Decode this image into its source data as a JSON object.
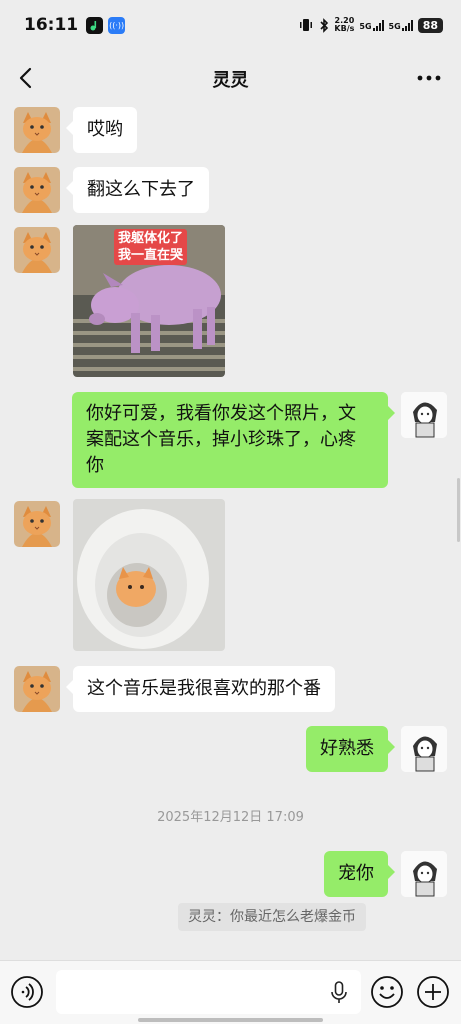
{
  "status_bar": {
    "time": "16:11",
    "net_speed_value": "2.20",
    "net_speed_unit": "KB/s",
    "signal1": "5G",
    "signal2": "5G",
    "battery": "88"
  },
  "nav": {
    "title": "灵灵",
    "back_icon": "chevron-left-icon",
    "more_icon": "more-horizontal-icon"
  },
  "messages": [
    {
      "from": "other",
      "type": "text",
      "text": "哎哟"
    },
    {
      "from": "other",
      "type": "text",
      "text": "翻这么下去了"
    },
    {
      "from": "other",
      "type": "image",
      "description": "pig",
      "caption_line1": "我躯体化了",
      "caption_line2": "我一直在哭"
    },
    {
      "from": "me",
      "type": "text",
      "text_line1": "你好可爱，我看你发这个照片，文",
      "text_line2": "案配这个音乐，掉小珍珠了，心疼",
      "text_line3": "你"
    },
    {
      "from": "other",
      "type": "image",
      "description": "kitten-in-toilet"
    },
    {
      "from": "other",
      "type": "text",
      "text": "这个音乐是我很喜欢的那个番"
    },
    {
      "from": "me",
      "type": "text",
      "text": "好熟悉"
    },
    {
      "from": "me",
      "type": "text",
      "text": "宠你"
    }
  ],
  "timestamp": "2025年12月12日 17:09",
  "system_notice": "灵灵：你最近怎么老爆金币",
  "input_bar": {
    "voice_icon": "voice-icon",
    "mic_icon": "microphone-icon",
    "emoji_icon": "emoji-icon",
    "plus_icon": "plus-icon"
  },
  "colors": {
    "background": "#ededed",
    "out_bubble": "#95ec69",
    "in_bubble": "#ffffff"
  }
}
